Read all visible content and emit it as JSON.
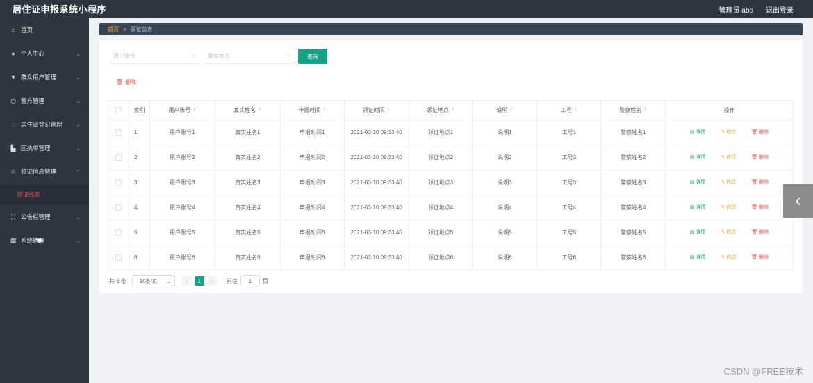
{
  "app": {
    "title": "居住证申报系统小程序"
  },
  "topbar": {
    "admin_label": "管理员 abo",
    "logout_label": "退出登录"
  },
  "sidebar": {
    "items": [
      {
        "label": "首页",
        "icon": "home-icon",
        "glyph": "⌂",
        "has_chevron": false
      },
      {
        "label": "个人中心",
        "icon": "user-icon",
        "glyph": "●",
        "has_chevron": true,
        "chevron": "⌄"
      },
      {
        "label": "群众用户管理",
        "icon": "users-icon",
        "glyph": "▼",
        "has_chevron": true,
        "chevron": "⌄"
      },
      {
        "label": "警方管理",
        "icon": "clock-icon",
        "glyph": "◷",
        "has_chevron": true,
        "chevron": "⌄"
      },
      {
        "label": "居住证登记管理",
        "icon": "register-icon",
        "glyph": "◌",
        "has_chevron": true,
        "chevron": "⌄"
      },
      {
        "label": "回执单管理",
        "icon": "receipt-icon",
        "glyph": "▙",
        "has_chevron": true,
        "chevron": "⌄"
      },
      {
        "label": "领证信息管理",
        "icon": "certificate-icon",
        "glyph": "♲",
        "has_chevron": true,
        "chevron": "⌃"
      },
      {
        "label": "公告栏管理",
        "icon": "notice-icon",
        "glyph": "⛶",
        "has_chevron": true,
        "chevron": "⌄"
      },
      {
        "label": "系统管理",
        "icon": "system-icon",
        "glyph": "▦",
        "has_chevron": true,
        "chevron": "⌄"
      }
    ],
    "active_sub_item": "领证信息"
  },
  "breadcrumb": {
    "home": "首页",
    "separator": ">",
    "current": "领证信息"
  },
  "search": {
    "user_account_placeholder": "用户账号",
    "police_name_placeholder": "警察姓名",
    "query_button": "查询",
    "search_icon_glyph": "○"
  },
  "delete_button": {
    "label": "删除",
    "glyph": "🗑"
  },
  "table": {
    "sort_glyph": "⇕",
    "headers": {
      "index": "索引",
      "user_account": "用户账号",
      "real_name": "真实姓名",
      "apply_time": "申报时间",
      "collect_time": "领证时间",
      "collect_place": "领证地点",
      "note": "说明",
      "work_no": "工号",
      "police_name": "警察姓名",
      "ops": "操作"
    },
    "ops_labels": {
      "detail": "详情",
      "edit": "修改",
      "delete": "删除"
    },
    "rows": [
      {
        "index": "1",
        "user_account": "用户账号1",
        "real_name": "真实姓名1",
        "apply_time": "申报时间1",
        "collect_time": "2021-03-10 09:33:40",
        "collect_place": "领证地点1",
        "note": "说明1",
        "work_no": "工号1",
        "police_name": "警察姓名1"
      },
      {
        "index": "2",
        "user_account": "用户账号2",
        "real_name": "真实姓名2",
        "apply_time": "申报时间2",
        "collect_time": "2021-03-10 09:33:40",
        "collect_place": "领证地点2",
        "note": "说明2",
        "work_no": "工号2",
        "police_name": "警察姓名2"
      },
      {
        "index": "3",
        "user_account": "用户账号3",
        "real_name": "真实姓名3",
        "apply_time": "申报时间3",
        "collect_time": "2021-03-10 09:33:40",
        "collect_place": "领证地点3",
        "note": "说明3",
        "work_no": "工号3",
        "police_name": "警察姓名3"
      },
      {
        "index": "4",
        "user_account": "用户账号4",
        "real_name": "真实姓名4",
        "apply_time": "申报时间4",
        "collect_time": "2021-03-10 09:33:40",
        "collect_place": "领证地点4",
        "note": "说明4",
        "work_no": "工号4",
        "police_name": "警察姓名4"
      },
      {
        "index": "5",
        "user_account": "用户账号5",
        "real_name": "真实姓名5",
        "apply_time": "申报时间5",
        "collect_time": "2021-03-10 09:33:40",
        "collect_place": "领证地点5",
        "note": "说明5",
        "work_no": "工号5",
        "police_name": "警察姓名5"
      },
      {
        "index": "6",
        "user_account": "用户账号6",
        "real_name": "真实姓名6",
        "apply_time": "申报时间6",
        "collect_time": "2021-03-10 09:33:40",
        "collect_place": "领证地点6",
        "note": "说明6",
        "work_no": "工号6",
        "police_name": "警察姓名6"
      }
    ]
  },
  "pagination": {
    "total": "共 6 条",
    "page_size": "10条/页",
    "current_page": "1",
    "goto_label": "前往",
    "goto_value": "1",
    "page_suffix": "页"
  },
  "side_arrow_glyph": "‹",
  "watermark": "CSDN @FREE技术",
  "colors": {
    "sidebar": "#2d3640",
    "accent": "#17a085",
    "danger": "#e84f4f",
    "warning": "#e6a23c"
  }
}
